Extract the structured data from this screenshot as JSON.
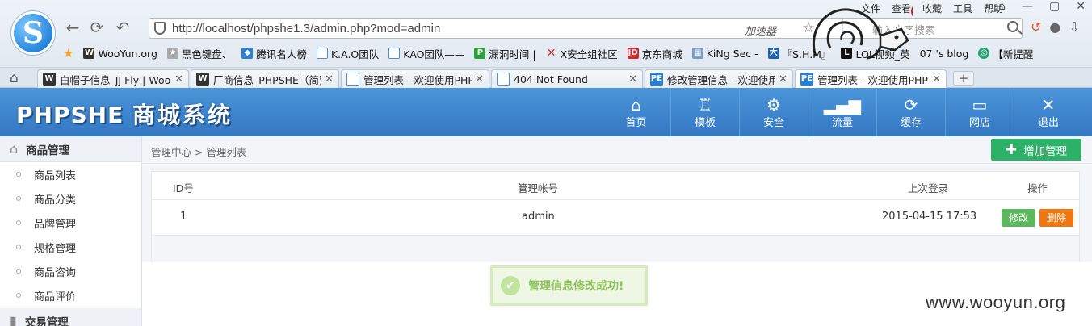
{
  "browser": {
    "url": "http://localhost/phpshe1.3/admin.php?mod=admin",
    "accelerator_label": "加速器",
    "search_placeholder": "输入文字搜索",
    "menu": [
      "文件",
      "查看",
      "收藏",
      "工具",
      "帮助"
    ],
    "bookmarks": [
      {
        "label": "WooYun.org",
        "icon": "wooyun-icon",
        "color": "#333333"
      },
      {
        "label": "黑色键盘、",
        "icon": "star-icon",
        "color": "#888888"
      },
      {
        "label": "腾讯名人榜",
        "icon": "shield-icon",
        "color": "#2d7fd3"
      },
      {
        "label": "K.A.O团队",
        "icon": "page-icon",
        "color": "#4a8fd8"
      },
      {
        "label": "KAO团队——",
        "icon": "page-icon",
        "color": "#4a8fd8"
      },
      {
        "label": "漏洞时间 |",
        "icon": "p-icon",
        "color": "#2ca33a"
      },
      {
        "label": "X安全组社区",
        "icon": "x-icon",
        "color": "#d9272e"
      },
      {
        "label": "京东商城",
        "icon": "jd-icon",
        "color": "#d9272e"
      },
      {
        "label": "KiNg Sec -",
        "icon": "image-icon",
        "color": "#7a9cc4"
      },
      {
        "label": "『S.H.M』",
        "icon": "da-icon",
        "color": "#1f5fb0"
      },
      {
        "label": "LOL视频_英",
        "icon": "l-icon",
        "color": "#111111"
      },
      {
        "label": "07 's blog",
        "icon": "blog-icon",
        "color": "#444444"
      },
      {
        "label": "【新提醒",
        "icon": "swirl-icon",
        "color": "#28a07a"
      }
    ],
    "tabs": [
      {
        "label": "白帽子信息_JJ Fly | Woo",
        "favicon": "wooyun-icon",
        "fav_text": "W",
        "fav_color": "#333333"
      },
      {
        "label": "厂商信息_PHPSHE（简要",
        "favicon": "wooyun-icon",
        "fav_text": "W",
        "fav_color": "#333333"
      },
      {
        "label": "管理列表 - 欢迎使用PHP",
        "favicon": "page-icon",
        "fav_text": "",
        "fav_color": "#4a8fd8"
      },
      {
        "label": "404 Not Found",
        "favicon": "page-icon",
        "fav_text": "",
        "fav_color": "#4a8fd8"
      },
      {
        "label": "修改管理信息 - 欢迎使用",
        "favicon": "pe-icon",
        "fav_text": "PE",
        "fav_color": "#2a7fd0"
      },
      {
        "label": "管理列表 - 欢迎使用PHP",
        "favicon": "pe-icon",
        "fav_text": "PE",
        "fav_color": "#2a7fd0"
      }
    ],
    "active_tab": 5
  },
  "admin": {
    "brand_latin": "PHPSHE",
    "brand_cn": "商城系统",
    "topnav": [
      {
        "label": "首页",
        "icon": "home-icon",
        "glyph": "⌂"
      },
      {
        "label": "模板",
        "icon": "shirt-icon",
        "glyph": "👕"
      },
      {
        "label": "安全",
        "icon": "gear-icon",
        "glyph": "⚙"
      },
      {
        "label": "流量",
        "icon": "bar-chart-icon",
        "glyph": "▮"
      },
      {
        "label": "缓存",
        "icon": "refresh-icon",
        "glyph": "⟳"
      },
      {
        "label": "网店",
        "icon": "monitor-icon",
        "glyph": "▭"
      },
      {
        "label": "退出",
        "icon": "close-icon",
        "glyph": "✕"
      }
    ],
    "sidebar": {
      "group1": "商品管理",
      "items": [
        "商品列表",
        "商品分类",
        "品牌管理",
        "规格管理",
        "商品咨询",
        "商品评价"
      ],
      "group2": "交易管理"
    },
    "breadcrumb": "管理中心 > 管理列表",
    "add_button": "增加管理",
    "table": {
      "headers": {
        "id": "ID号",
        "account": "管理帐号",
        "last_login": "上次登录",
        "actions": "操作"
      },
      "rows": [
        {
          "id": "1",
          "account": "admin",
          "last_login": "2015-04-15 17:53",
          "edit": "修改",
          "delete": "删除"
        }
      ]
    },
    "toast": "管理信息修改成功!"
  },
  "watermark": "www.wooyun.org"
}
